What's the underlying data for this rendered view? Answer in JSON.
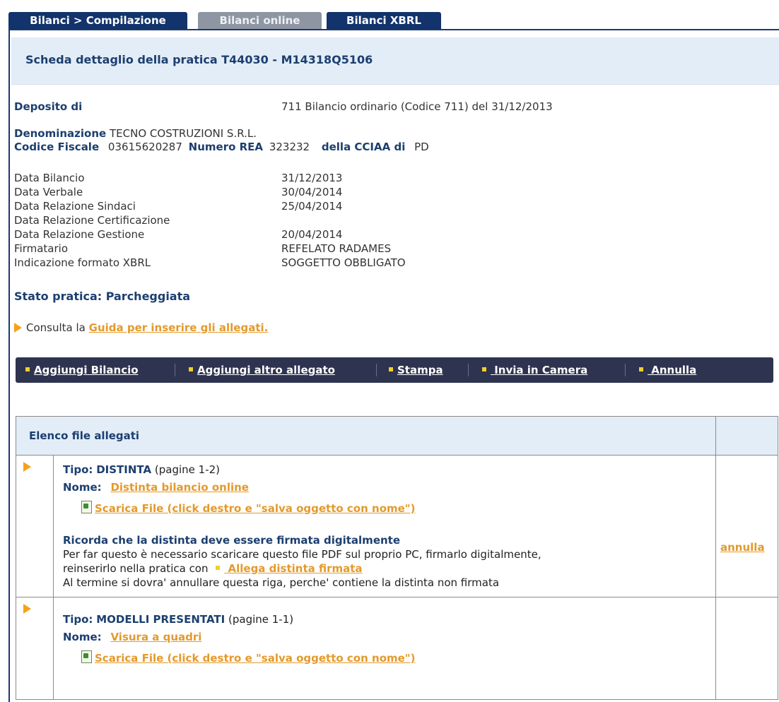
{
  "tabs": [
    {
      "label": "Bilanci > Compilazione"
    },
    {
      "label": "Bilanci online"
    },
    {
      "label": "Bilanci XBRL"
    }
  ],
  "header": {
    "title": "Scheda dettaglio della pratica T44030 - M14318Q5106"
  },
  "deposito": {
    "label": "Deposito di",
    "value": "711 Bilancio ordinario (Codice 711) del 31/12/2013"
  },
  "company": {
    "denominazione_label": "Denominazione",
    "denominazione_value": "TECNO COSTRUZIONI S.R.L.",
    "cf_label": "Codice Fiscale",
    "cf_value": "03615620287",
    "rea_label": "Numero REA",
    "rea_value": "323232",
    "cciaa_label": "della CCIAA di",
    "cciaa_value": "PD"
  },
  "fields": [
    {
      "label": "Data Bilancio",
      "value": "31/12/2013"
    },
    {
      "label": "Data Verbale",
      "value": "30/04/2014"
    },
    {
      "label": "Data Relazione Sindaci",
      "value": "25/04/2014"
    },
    {
      "label": "Data Relazione Certificazione",
      "value": ""
    },
    {
      "label": "Data Relazione Gestione",
      "value": "20/04/2014"
    },
    {
      "label": "Firmatario",
      "value": "REFELATO  RADAMES"
    },
    {
      "label": "Indicazione formato XBRL",
      "value": "SOGGETTO OBBLIGATO"
    }
  ],
  "status": {
    "text": "Stato pratica:  Parcheggiata"
  },
  "guide": {
    "prefix": "Consulta la",
    "link": "Guida per inserire gli allegati."
  },
  "toolbar": {
    "items": [
      {
        "label": "Aggiungi Bilancio"
      },
      {
        "label": "Aggiungi altro allegato"
      },
      {
        "label": "Stampa"
      },
      {
        "label": " Invia in Camera"
      },
      {
        "label": " Annulla"
      }
    ]
  },
  "attachments": {
    "header": "Elenco file allegati",
    "rows": [
      {
        "tipo_label": "Tipo:",
        "tipo_value": "DISTINTA",
        "pages": "(pagine 1-2)",
        "nome_label": "Nome:",
        "nome_value": "Distinta bilancio online",
        "download": "Scarica File (click destro e \"salva oggetto con nome\")",
        "note_title": "Ricorda che la distinta deve essere firmata digitalmente",
        "note_line1": "Per far questo è necessario scaricare questo file PDF sul proprio PC, firmarlo digitalmente,",
        "note_line2_prefix": "reinserirlo nella pratica con",
        "note_line2_link": " Allega distinta firmata",
        "note_line3": "Al termine si dovra' annullare questa riga, perche' contiene la distinta non firmata",
        "action": "annulla"
      },
      {
        "tipo_label": "Tipo:",
        "tipo_value": "MODELLI PRESENTATI",
        "pages": "(pagine 1-1)",
        "nome_label": "Nome:",
        "nome_value": "Visura a quadri",
        "download": "Scarica File (click destro e \"salva oggetto con nome\")"
      }
    ]
  }
}
